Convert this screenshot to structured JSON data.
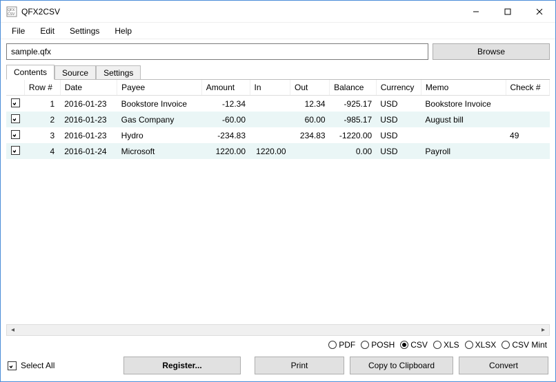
{
  "window": {
    "title": "QFX2CSV"
  },
  "menu": {
    "file": "File",
    "edit": "Edit",
    "settings": "Settings",
    "help": "Help"
  },
  "file_row": {
    "value": "sample.qfx",
    "browse": "Browse"
  },
  "tabs": {
    "contents": "Contents",
    "source": "Source",
    "settings": "Settings"
  },
  "columns": {
    "row": "Row #",
    "date": "Date",
    "payee": "Payee",
    "amount": "Amount",
    "in": "In",
    "out": "Out",
    "balance": "Balance",
    "currency": "Currency",
    "memo": "Memo",
    "checkno": "Check #"
  },
  "rows": [
    {
      "n": "1",
      "date": "2016-01-23",
      "payee": "Bookstore Invoice",
      "amount": "-12.34",
      "in": "",
      "out": "12.34",
      "balance": "-925.17",
      "currency": "USD",
      "memo": "Bookstore Invoice",
      "checkno": ""
    },
    {
      "n": "2",
      "date": "2016-01-23",
      "payee": "Gas Company",
      "amount": "-60.00",
      "in": "",
      "out": "60.00",
      "balance": "-985.17",
      "currency": "USD",
      "memo": "August bill",
      "checkno": ""
    },
    {
      "n": "3",
      "date": "2016-01-23",
      "payee": "Hydro",
      "amount": "-234.83",
      "in": "",
      "out": "234.83",
      "balance": "-1220.00",
      "currency": "USD",
      "memo": "",
      "checkno": "49"
    },
    {
      "n": "4",
      "date": "2016-01-24",
      "payee": "Microsoft",
      "amount": "1220.00",
      "in": "1220.00",
      "out": "",
      "balance": "0.00",
      "currency": "USD",
      "memo": "Payroll",
      "checkno": ""
    }
  ],
  "formats": {
    "pdf": "PDF",
    "posh": "POSH",
    "csv": "CSV",
    "xls": "XLS",
    "xlsx": "XLSX",
    "csvmint": "CSV Mint"
  },
  "bottom": {
    "select_all": "Select All",
    "register": "Register...",
    "print": "Print",
    "copy": "Copy to Clipboard",
    "convert": "Convert"
  }
}
